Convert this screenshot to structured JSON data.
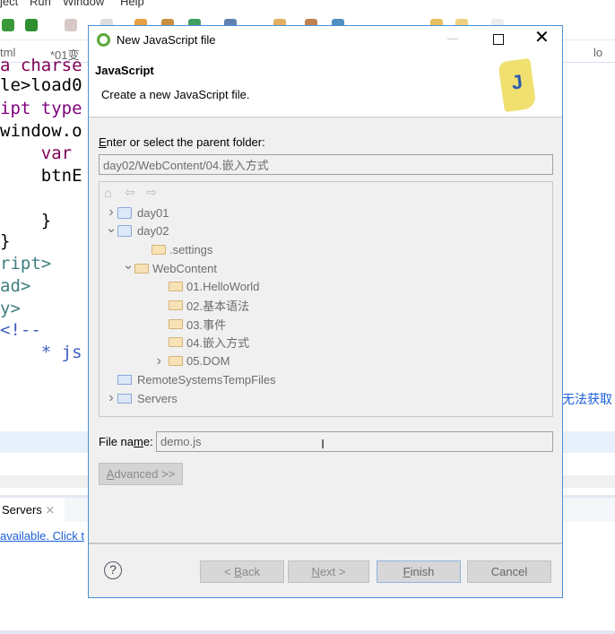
{
  "background": {
    "menu": [
      "ject",
      "Run",
      "Window",
      "Help"
    ],
    "tabs": [
      "tml",
      "*01变",
      "lo"
    ],
    "code_lines": [
      {
        "text": "a charse",
        "color": "#7f0055"
      },
      {
        "text": "le>load0",
        "color": "#000"
      },
      {
        "text": "ipt type",
        "color": "#7f007f"
      },
      {
        "text": "window.o",
        "color": "#000"
      },
      {
        "text": "    var",
        "color": "#7f0055"
      },
      {
        "text": "    btnE",
        "color": "#000"
      },
      {
        "text": "    }",
        "color": "#000"
      },
      {
        "text": "}",
        "color": "#000"
      },
      {
        "text": "ript>",
        "color": "#3f7f7f"
      },
      {
        "text": "ad>",
        "color": "#3f7f7f"
      },
      {
        "text": "y>",
        "color": "#3f7f7f"
      },
      {
        "text": "<!--",
        "color": "#3f5fbf"
      },
      {
        "text": "    * js",
        "color": "#3f5fbf"
      }
    ],
    "right_text": "无法获取",
    "servers_tab": "Servers",
    "servers_link": "available. Click t"
  },
  "dialog": {
    "title": "New JavaScript file",
    "header_title": "JavaScript",
    "header_desc": "Create a new JavaScript file.",
    "folder_label_accel": "E",
    "folder_label": "nter or select the parent folder:",
    "folder_value": "day02/WebContent/04.嵌入方式",
    "tree": [
      {
        "label": "day01",
        "type": "project",
        "expanded": false
      },
      {
        "label": "day02",
        "type": "project",
        "expanded": true
      },
      {
        "label": ".settings",
        "type": "folder"
      },
      {
        "label": "WebContent",
        "type": "folder",
        "expanded": true
      },
      {
        "label": "01.HelloWorld",
        "type": "folder"
      },
      {
        "label": "02.基本语法",
        "type": "folder"
      },
      {
        "label": "03.事件",
        "type": "folder"
      },
      {
        "label": "04.嵌入方式",
        "type": "folder"
      },
      {
        "label": "05.DOM",
        "type": "folder",
        "expanded": false
      },
      {
        "label": "RemoteSystemsTempFiles",
        "type": "project-folder"
      },
      {
        "label": "Servers",
        "type": "project-folder",
        "expanded": false
      }
    ],
    "file_label_a": "File na",
    "file_label_m": "m",
    "file_label_b": "e:",
    "file_value": "demo.js",
    "advanced": {
      "accel": "A",
      "rest": "dvanced >>"
    },
    "buttons": {
      "back_pre": "< ",
      "back_accel": "B",
      "back_rest": "ack",
      "next_accel": "N",
      "next_rest": "ext >",
      "finish_accel": "F",
      "finish_rest": "inish",
      "cancel": "Cancel"
    },
    "help_glyph": "?"
  }
}
